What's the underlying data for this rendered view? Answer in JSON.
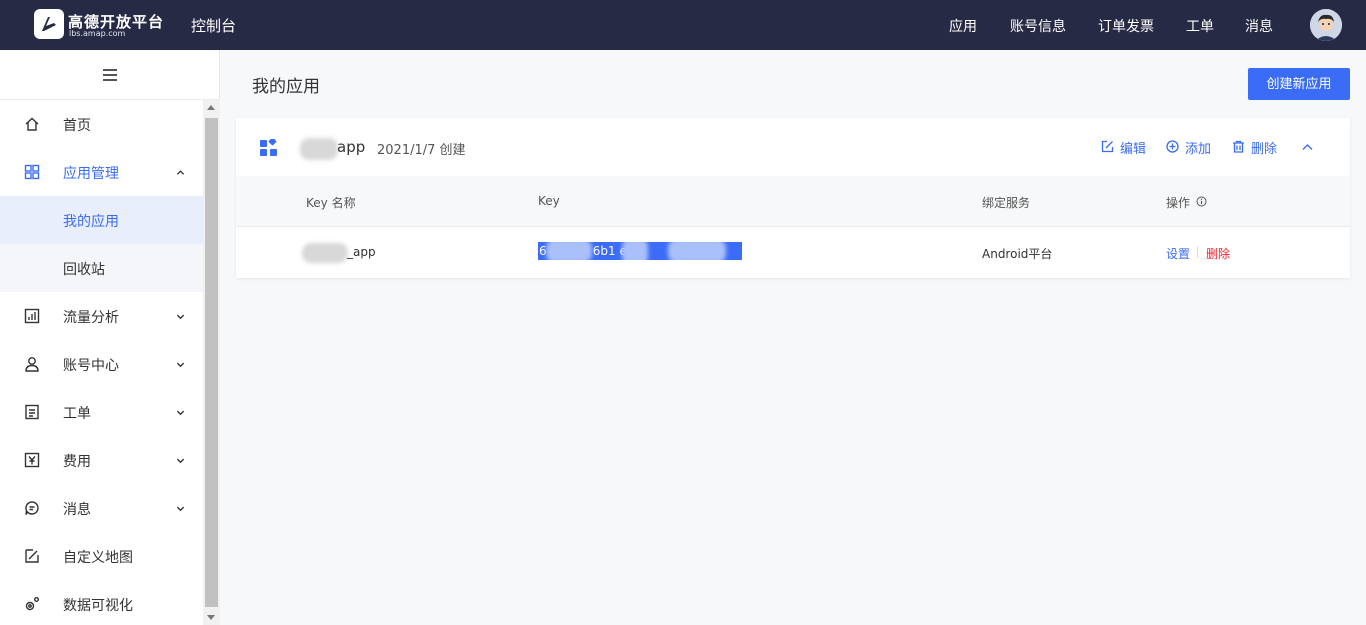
{
  "header": {
    "brand_title": "高德开放平台",
    "brand_subtitle": "lbs.amap.com",
    "console_label": "控制台",
    "nav": [
      "应用",
      "账号信息",
      "订单发票",
      "工单",
      "消息"
    ]
  },
  "sidebar": {
    "items": [
      {
        "label": "首页",
        "icon": "home-icon"
      },
      {
        "label": "应用管理",
        "icon": "apps-grid-icon",
        "expanded": true
      },
      {
        "label": "我的应用",
        "sub": true,
        "active": true
      },
      {
        "label": "回收站",
        "sub": true
      },
      {
        "label": "流量分析",
        "icon": "chart-icon"
      },
      {
        "label": "账号中心",
        "icon": "user-icon"
      },
      {
        "label": "工单",
        "icon": "ticket-icon"
      },
      {
        "label": "费用",
        "icon": "yen-icon"
      },
      {
        "label": "消息",
        "icon": "message-icon"
      },
      {
        "label": "自定义地图",
        "icon": "custom-map-icon"
      },
      {
        "label": "数据可视化",
        "icon": "data-viz-icon"
      }
    ]
  },
  "main": {
    "title": "我的应用",
    "create_button": "创建新应用",
    "app": {
      "name_suffix": "app",
      "created": "2021/1/7 创建",
      "actions": {
        "edit": "编辑",
        "add": "添加",
        "delete": "删除"
      }
    },
    "table": {
      "headers": [
        "Key 名称",
        "Key",
        "绑定服务",
        "操作"
      ],
      "row": {
        "key_name_suffix": "_app",
        "key": "6          110ffa       6b1              e49",
        "service": "Android平台",
        "ops": {
          "settings": "设置",
          "delete": "删除"
        }
      }
    }
  },
  "colors": {
    "topbar": "#262a45",
    "accent": "#3b6cf6",
    "danger": "#f5222d"
  }
}
